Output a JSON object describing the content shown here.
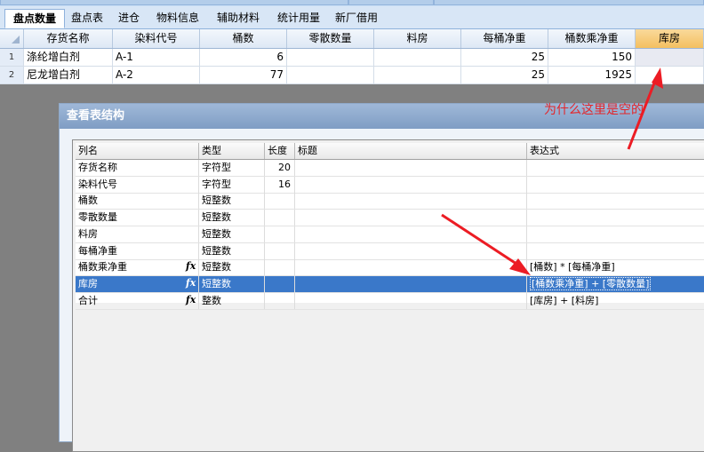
{
  "tabs": [
    "盘点数量",
    "盘点表",
    "进仓",
    "物料信息",
    "辅助材料",
    "统计用量",
    "新厂借用"
  ],
  "grid": {
    "headers": [
      "存货名称",
      "染料代号",
      "桶数",
      "零散数量",
      "料房",
      "每桶净重",
      "桶数乘净重",
      "库房"
    ],
    "rows": [
      {
        "n": "1",
        "name": "涤纶增白剂",
        "code": "A-1",
        "barrels": "6",
        "loose": "",
        "store": "",
        "per": "25",
        "prod": "150",
        "ku": ""
      },
      {
        "n": "2",
        "name": "尼龙增白剂",
        "code": "A-2",
        "barrels": "77",
        "loose": "",
        "store": "",
        "per": "25",
        "prod": "1925",
        "ku": ""
      }
    ]
  },
  "annotation": "为什么这里是空的",
  "dialog": {
    "title": "查看表结构",
    "headers": [
      "列名",
      "类型",
      "长度",
      "标题",
      "表达式"
    ],
    "rows": [
      {
        "name": "存货名称",
        "type": "字符型",
        "len": "20",
        "caption": "",
        "expr": "",
        "fx": false
      },
      {
        "name": "染料代号",
        "type": "字符型",
        "len": "16",
        "caption": "",
        "expr": "",
        "fx": false
      },
      {
        "name": "桶数",
        "type": "短整数",
        "len": "",
        "caption": "",
        "expr": "",
        "fx": false
      },
      {
        "name": "零散数量",
        "type": "短整数",
        "len": "",
        "caption": "",
        "expr": "",
        "fx": false
      },
      {
        "name": "料房",
        "type": "短整数",
        "len": "",
        "caption": "",
        "expr": "",
        "fx": false
      },
      {
        "name": "每桶净重",
        "type": "短整数",
        "len": "",
        "caption": "",
        "expr": "",
        "fx": false
      },
      {
        "name": "桶数乘净重",
        "type": "短整数",
        "len": "",
        "caption": "",
        "expr": "[桶数] * [每桶净重]",
        "fx": true
      },
      {
        "name": "库房",
        "type": "短整数",
        "len": "",
        "caption": "",
        "expr": "[桶数乘净重] + [零散数量]",
        "fx": true
      },
      {
        "name": "合计",
        "type": "整数",
        "len": "",
        "caption": "",
        "expr": "[库房] + [料房]",
        "fx": true
      }
    ],
    "fx_symbol": "fx",
    "highlight_row": 7
  },
  "colors": {
    "annotation": "#e3262a",
    "selection": "#3a78c9"
  }
}
